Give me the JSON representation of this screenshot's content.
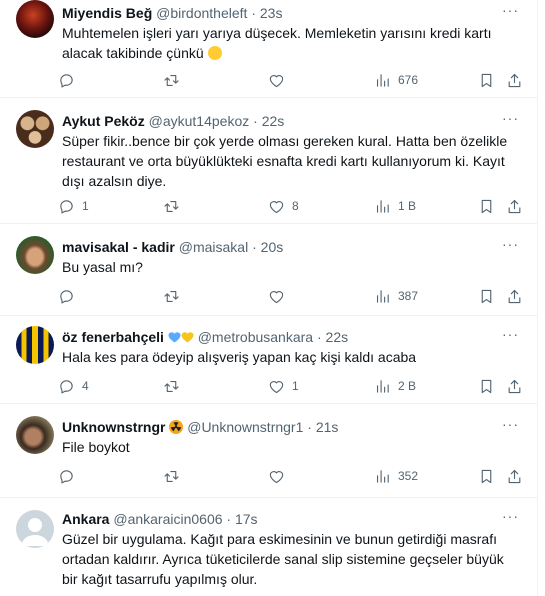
{
  "tweets": [
    {
      "name": "Miyendis Beğ",
      "handle": "@birdontheleft",
      "sep": "·",
      "time": "23s",
      "text": "Muhtemelen işleri yarı yarıya düşecek. Memleketin yarısını kredi kartı alacak takibinde çünkü",
      "views": "676",
      "replies": "",
      "retweets": "",
      "likes": ""
    },
    {
      "name": "Aykut Peköz",
      "handle": "@aykut14pekoz",
      "sep": "·",
      "time": "22s",
      "text": "Süper fikir..bence bir çok yerde olması gereken kural. Hatta ben özelikle restaurant ve orta büyüklükteki esnafta kredi kartı kullanıyorum ki. Kayıt dışı azalsın diye.",
      "views": "1 B",
      "replies": "1",
      "retweets": "",
      "likes": "8"
    },
    {
      "name": "mavisakal - kadir",
      "handle": "@maisakal",
      "sep": "·",
      "time": "20s",
      "text": "Bu yasal mı?",
      "views": "387",
      "replies": "",
      "retweets": "",
      "likes": ""
    },
    {
      "name": "öz fenerbahçeli",
      "handle": "@metrobusankara",
      "sep": "·",
      "time": "22s",
      "text": "Hala kes para ödeyip alışveriş yapan kaç kişi kaldı acaba",
      "views": "2 B",
      "replies": "4",
      "retweets": "",
      "likes": "1"
    },
    {
      "name": "Unknownstrngr",
      "handle": "@Unknownstrngr1",
      "sep": "·",
      "time": "21s",
      "text": "File boykot",
      "views": "352",
      "replies": "",
      "retweets": "",
      "likes": ""
    },
    {
      "name": "Ankara",
      "handle": "@ankaraicin0606",
      "sep": "·",
      "time": "17s",
      "text": "Güzel bir uygulama. Kağıt para eskimesinin ve bunun getirdiği masrafı ortadan kaldırır. Ayrıca tüketicilerde sanal slip sistemine geçseler büyük bir kağıt tasarrufu yapılmış olur."
    }
  ],
  "more_label": "···",
  "colors": {
    "text": "#0f1419",
    "secondary": "#536471",
    "border": "#eff3f4",
    "heart_blue": "#5aa9ff",
    "heart_yellow": "#f5c518"
  },
  "icons": {
    "reply": "reply-icon",
    "retweet": "retweet-icon",
    "like": "like-icon",
    "views": "views-icon",
    "bookmark": "bookmark-icon",
    "share": "share-icon",
    "more": "more-icon"
  }
}
